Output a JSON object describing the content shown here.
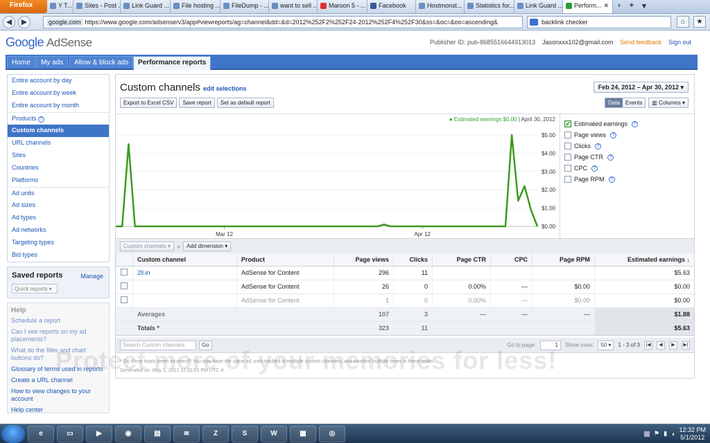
{
  "browser": {
    "app_button": "Firefox",
    "tabs": [
      {
        "label": "Y T..."
      },
      {
        "label": "Sites - Post ..."
      },
      {
        "label": "Link Guard ..."
      },
      {
        "label": "File hosting ..."
      },
      {
        "label": "FileDump - ..."
      },
      {
        "label": "want to sell ..."
      },
      {
        "label": "Maroon 5 - ..."
      },
      {
        "label": "Facebook"
      },
      {
        "label": "Hostmonst..."
      },
      {
        "label": "Statistics for..."
      },
      {
        "label": "Link Guard ..."
      },
      {
        "label": "Perform..."
      }
    ],
    "url_domain": "google.com",
    "url": "https://www.google.com/adsense/v3/app#viewreports/ag=channel&dd=&d=2012%252F2%252F24-2012%252F4%252F30&ss=&oc=&oo=ascending&",
    "search_value": "backlink checker"
  },
  "header": {
    "logo_word": "Google",
    "logo_product": "AdSense",
    "publisher_id": "Publisher ID: pub-8685516644913013",
    "email": "Jasonxxx102@gmail.com",
    "send_feedback": "Send feedback",
    "sign_out": "Sign out"
  },
  "nav": {
    "tabs": [
      {
        "label": "Home"
      },
      {
        "label": "My ads"
      },
      {
        "label": "Allow & block ads"
      },
      {
        "label": "Performance reports"
      }
    ]
  },
  "sidebar": {
    "group1": [
      "Entire account by day",
      "Entire account by week",
      "Entire account by month"
    ],
    "group2": [
      "Products",
      "Custom channels",
      "URL channels",
      "Sites",
      "Countries",
      "Platforms"
    ],
    "group3": [
      "Ad units",
      "Ad sizes",
      "Ad types",
      "Ad networks",
      "Targeting types",
      "Bid types"
    ],
    "saved_reports": "Saved reports",
    "manage": "Manage",
    "quick_reports": "Quick reports",
    "help_title": "Help",
    "help_items": [
      "Schedule a report",
      "Can I see reports on my ad placements?",
      "What do the filter and chart buttons do?",
      "Glossary of terms used in reports",
      "Create a URL channel",
      "How to view changes to your account",
      "Help center"
    ]
  },
  "report": {
    "title": "Custom channels",
    "edit_selections": "edit selections",
    "date_range": "Feb 24, 2012 – Apr 30, 2012",
    "buttons": [
      "Export to Excel CSV",
      "Save report",
      "Set as default report"
    ],
    "view_data": "Data",
    "view_events": "Events",
    "columns": "Columns",
    "legend_metric": "Estimated earnings $0.00",
    "legend_date": "April 30, 2012",
    "metrics": [
      {
        "label": "Estimated earnings",
        "checked": true
      },
      {
        "label": "Page views",
        "checked": false
      },
      {
        "label": "Clicks",
        "checked": false
      },
      {
        "label": "Page CTR",
        "checked": false
      },
      {
        "label": "CPC",
        "checked": false
      },
      {
        "label": "Page RPM",
        "checked": false
      }
    ],
    "dimension_select": "Custom channels",
    "add_dimension": "Add dimension",
    "columns_headers": [
      "Custom channel",
      "Product",
      "Page views",
      "Clicks",
      "Page CTR",
      "CPC",
      "Page RPM",
      "Estimated earnings ↓"
    ],
    "rows": [
      {
        "channel": "2ll.in",
        "product": "AdSense for Content",
        "page_views": "296",
        "clicks": "11",
        "ctr": "",
        "cpc": "",
        "rpm": "",
        "earnings": "$5.63"
      },
      {
        "channel": "",
        "product": "AdSense for Content",
        "page_views": "26",
        "clicks": "0",
        "ctr": "0.00%",
        "cpc": "—",
        "rpm": "$0.00",
        "earnings": "$0.00"
      },
      {
        "channel": "",
        "product": "AdSense for Content",
        "page_views": "1",
        "clicks": "0",
        "ctr": "0.00%",
        "cpc": "—",
        "rpm": "$0.00",
        "earnings": "$0.00"
      }
    ],
    "averages": {
      "label": "Averages",
      "page_views": "107",
      "clicks": "3",
      "ctr": "—",
      "cpc": "—",
      "rpm": "—",
      "earnings": "$1.88"
    },
    "totals": {
      "label": "Totals *",
      "page_views": "323",
      "clicks": "11",
      "earnings": "$5.63"
    },
    "search_placeholder": "Search Custom channels",
    "go": "Go",
    "go_to_page": "Go to page:",
    "page_value": "1",
    "show_rows": "Show rows:",
    "rows_value": "50",
    "range": "1 - 3 of 3",
    "footnote": "* Do these totals seem incorrect? You may have the same ad units tracked in multiple custom channels, and counted multiple times in these totals.",
    "generated": "Generated on: May 1, 2012 12:32:01 PM UTC-4"
  },
  "chart_data": {
    "type": "line",
    "series": [
      {
        "name": "Estimated earnings",
        "color": "#3c9a1e",
        "points": [
          [
            "Feb 24",
            0
          ],
          [
            "Feb 25",
            0
          ],
          [
            "Feb 26",
            4.5
          ],
          [
            "Feb 27",
            0
          ],
          [
            "Feb 28",
            0
          ],
          [
            "Mar 12",
            0
          ],
          [
            "Apr 5",
            0
          ],
          [
            "Apr 6",
            0.1
          ],
          [
            "Apr 7",
            0
          ],
          [
            "Apr 24",
            0
          ],
          [
            "Apr 25",
            0
          ],
          [
            "Apr 26",
            5.0
          ],
          [
            "Apr 27",
            1.4
          ],
          [
            "Apr 28",
            2.2
          ],
          [
            "Apr 29",
            0.9
          ],
          [
            "Apr 30",
            0
          ]
        ]
      }
    ],
    "x_ticks": [
      "Mar 12",
      "Apr 12"
    ],
    "y_ticks": [
      "$0.00",
      "$1.00",
      "$2.00",
      "$3.00",
      "$4.00",
      "$5.00"
    ],
    "ylim": [
      0,
      5.0
    ]
  },
  "watermark": "Protect more of your memories for less!",
  "taskbar": {
    "time": "12:32 PM",
    "date": "5/1/2012",
    "apps": [
      "IE",
      "Files",
      "Media",
      "Firefox",
      "Term",
      "Spotify",
      "FileZilla",
      "Skype",
      "Word",
      "Calc",
      "Other"
    ]
  }
}
